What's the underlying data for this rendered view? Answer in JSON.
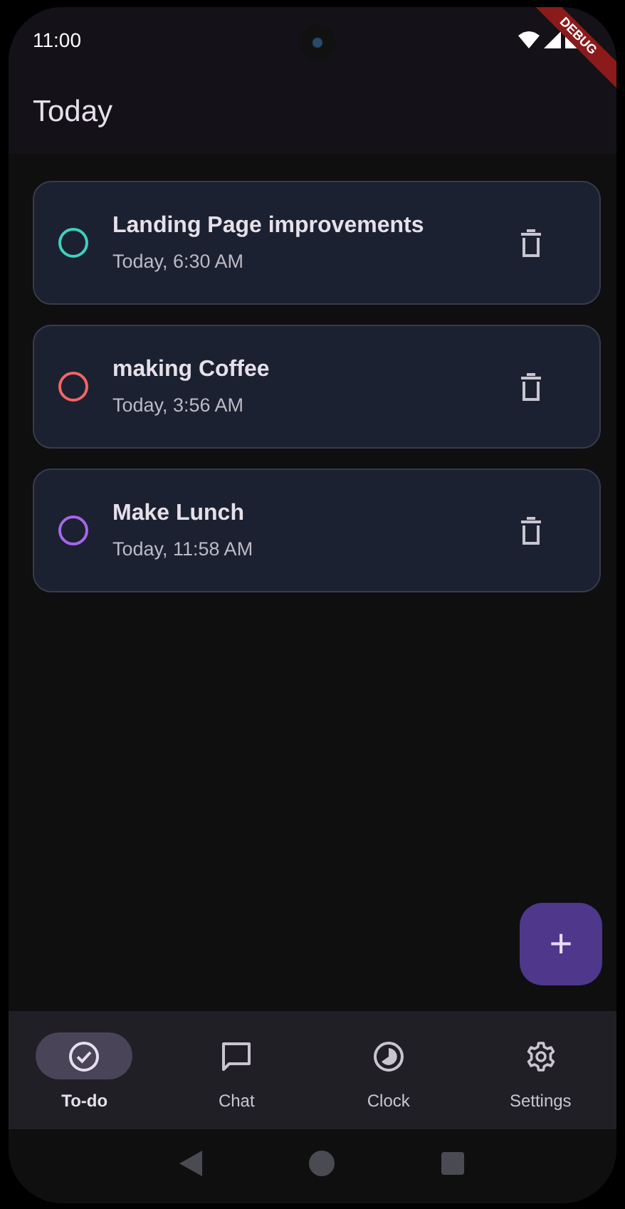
{
  "status_bar": {
    "time": "11:00"
  },
  "debug_banner": "DEBUG",
  "app_bar": {
    "title": "Today"
  },
  "todos": [
    {
      "title": "Landing Page improvements",
      "time": "Today, 6:30 AM",
      "color": "#3fcfc0",
      "done": false
    },
    {
      "title": "making Coffee",
      "time": "Today, 3:56 AM",
      "color": "#f26565",
      "done": false
    },
    {
      "title": "Make Lunch",
      "time": "Today, 11:58 AM",
      "color": "#a467e8",
      "done": false
    }
  ],
  "fab": {
    "label": "+"
  },
  "nav": [
    {
      "kind": "todo",
      "label": "To-do",
      "selected": true
    },
    {
      "kind": "chat",
      "label": "Chat",
      "selected": false
    },
    {
      "kind": "clock",
      "label": "Clock",
      "selected": false
    },
    {
      "kind": "settings",
      "label": "Settings",
      "selected": false
    }
  ]
}
